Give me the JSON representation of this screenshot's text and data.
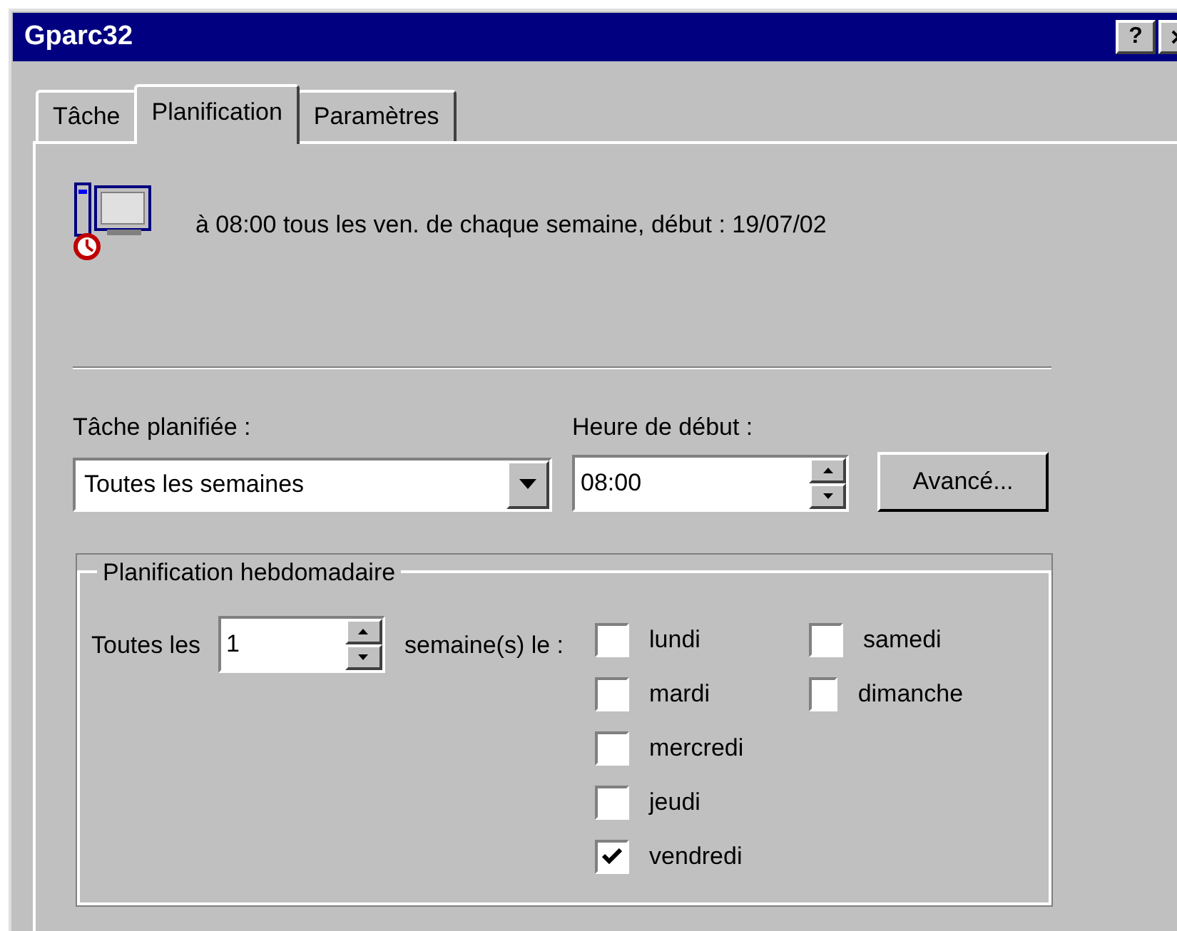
{
  "window": {
    "title": "Gparc32",
    "buttons": [
      "?"
    ]
  },
  "tabs": [
    {
      "label": "Tâche",
      "selected": false
    },
    {
      "label": "Planification",
      "selected": true
    },
    {
      "label": "Paramètres",
      "selected": false
    }
  ],
  "summary": "à 08:00 tous les ven. de chaque semaine, début : 19/07/02",
  "schedule": {
    "label": "Tâche planifiée :",
    "value": "Toutes les semaines"
  },
  "start_time": {
    "label": "Heure de début :",
    "value": "08:00"
  },
  "advanced_button": {
    "label": "Avancé..."
  },
  "weekly": {
    "title": "Planification hebdomadaire",
    "every_label": "Toutes les",
    "every_value": "1",
    "weeks_label": "semaine(s) le :",
    "days": [
      [
        {
          "label": "lundi",
          "checked": false
        },
        {
          "label": "mardi",
          "checked": false
        },
        {
          "label": "mercredi",
          "checked": false
        },
        {
          "label": "jeudi",
          "checked": false
        },
        {
          "label": "vendredi",
          "checked": true
        }
      ],
      [
        {
          "label": "samedi",
          "checked": false
        },
        {
          "label": "dimanche",
          "checked": false
        }
      ]
    ]
  }
}
